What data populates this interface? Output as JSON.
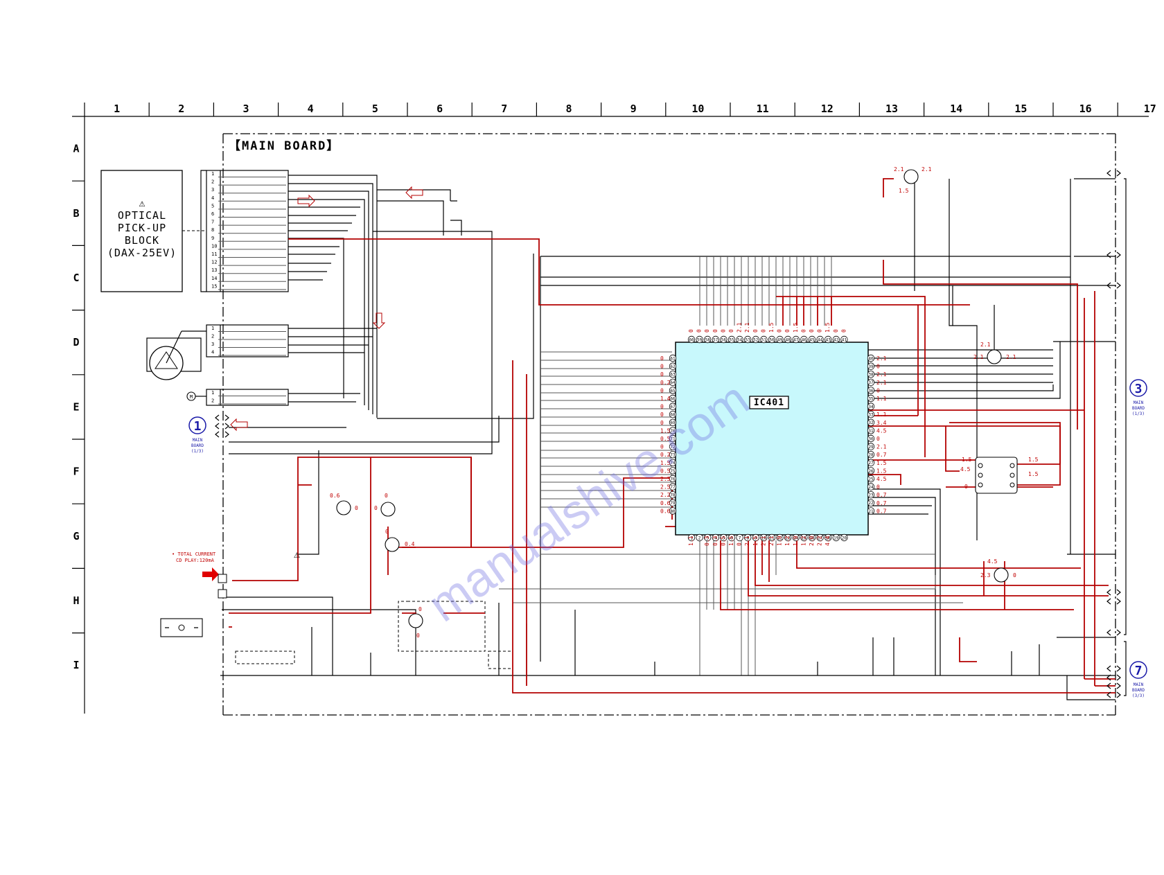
{
  "grid": {
    "columns": [
      "1",
      "2",
      "3",
      "4",
      "5",
      "6",
      "7",
      "8",
      "9",
      "10",
      "11",
      "12",
      "13",
      "14",
      "15",
      "16",
      "17"
    ],
    "rows": [
      "A",
      "B",
      "C",
      "D",
      "E",
      "F",
      "G",
      "H",
      "I"
    ]
  },
  "board_title": "【MAIN BOARD】",
  "optical_block": {
    "warning_symbol": "⚠",
    "lines": [
      "OPTICAL",
      "PICK-UP",
      "BLOCK",
      "(DAX-25EV)"
    ]
  },
  "connector_pins_15": [
    "1",
    "2",
    "3",
    "4",
    "5",
    "6",
    "7",
    "8",
    "9",
    "10",
    "11",
    "12",
    "13",
    "14",
    "15"
  ],
  "connector_pins_4": [
    "1",
    "2",
    "3",
    "4"
  ],
  "connector_pins_2": [
    "1",
    "2"
  ],
  "ic": {
    "label": "IC401"
  },
  "ic_pins_top": [
    "60",
    "59",
    "58",
    "57",
    "56",
    "55",
    "54",
    "53",
    "52",
    "51",
    "50",
    "49",
    "48",
    "47",
    "46",
    "45",
    "44",
    "43",
    "42",
    "41"
  ],
  "ic_pins_left": [
    "61",
    "62",
    "63",
    "64",
    "65",
    "66",
    "67",
    "68",
    "69",
    "70",
    "71",
    "72",
    "73",
    "74",
    "75",
    "76",
    "77",
    "78",
    "79",
    "80"
  ],
  "ic_pins_right": [
    "40",
    "39",
    "38",
    "37",
    "36",
    "35",
    "34",
    "33",
    "32",
    "31",
    "30",
    "29",
    "28",
    "27",
    "26",
    "25",
    "24",
    "23",
    "22",
    "21"
  ],
  "ic_pins_bottom": [
    "1",
    "2",
    "3",
    "4",
    "5",
    "6",
    "7",
    "8",
    "9",
    "10",
    "11",
    "12",
    "13",
    "14",
    "15",
    "16",
    "17",
    "18",
    "19",
    "20"
  ],
  "voltages": {
    "top": [
      "0",
      "0",
      "0",
      "0",
      "0",
      "0",
      "2.1",
      "2.1",
      "0",
      "0",
      "1.5",
      "0",
      "0",
      "1.5",
      "0",
      "0",
      "0",
      "1.5",
      "0",
      "0"
    ],
    "left": [
      "0",
      "0",
      "0",
      "0.2",
      "0",
      "1.4",
      "0",
      "0",
      "0",
      "1.5",
      "0.5",
      "0",
      "0.2",
      "1.5",
      "0.5",
      "2.3",
      "2.5",
      "2.2",
      "0.6",
      "0.6"
    ],
    "right": [
      "2.1",
      "0",
      "2.1",
      "2.1",
      "0",
      "1.1",
      "",
      "1.1",
      "3.4",
      "4.5",
      "0",
      "2.1",
      "0.7",
      "1.5",
      "1.5",
      "4.5",
      "0",
      "0.7",
      "0.7",
      "0.7"
    ],
    "bottom": [
      "1.1",
      "",
      "0.3",
      "0.3",
      "0.5",
      "1.5",
      "0",
      "2.1",
      "1.5",
      "2.1",
      "2.1",
      "1.9",
      "1.2",
      "1.9",
      "1.2",
      "2.0",
      "2.2",
      "4.4",
      "",
      ""
    ]
  },
  "transistor_voltages": {
    "q_top": [
      "2.1",
      "2.1",
      "1.5"
    ],
    "q_mid_right": [
      "2.1",
      "2.1",
      "2.1"
    ],
    "q_f1": [
      "0.6",
      "0"
    ],
    "q_f2": [
      "0",
      "0"
    ],
    "q_g": [
      "0",
      "0.4"
    ],
    "q_h": [
      "0",
      "0"
    ],
    "q_h_right": [
      "4.5",
      "2.3",
      "0"
    ],
    "regulator": [
      "1.5",
      "4.5",
      "0",
      "1.5",
      "1.5"
    ]
  },
  "total_current_note": [
    "• TOTAL CURRENT",
    "CD PLAY:120mA"
  ],
  "warning_symbol": "⚠",
  "refs": [
    {
      "num": "1",
      "lines": [
        "MAIN",
        "BOARD",
        "(1/3)"
      ]
    },
    {
      "num": "3",
      "lines": [
        "MAIN",
        "BOARD",
        "(1/3)"
      ]
    },
    {
      "num": "7",
      "lines": [
        "MAIN",
        "BOARD",
        "(3/3)"
      ]
    }
  ],
  "watermark": "manualshive.com",
  "colors": {
    "wire_red": "#b40000",
    "ic_fill": "#c8f8fc",
    "ref_blue": "#1a1aa8",
    "arrow_red": "#e00000"
  }
}
